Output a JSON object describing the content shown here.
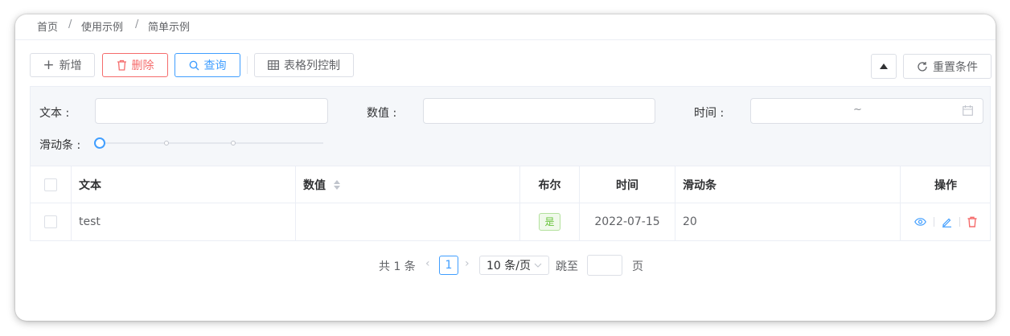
{
  "breadcrumb": {
    "home": "首页",
    "sep1": "/",
    "level2": "使用示例",
    "sep2": "/",
    "current": "简单示例"
  },
  "toolbar": {
    "add_label": "新增",
    "delete_label": "删除",
    "search_label": "查询",
    "columns_label": "表格列控制",
    "reset_label": "重置条件",
    "colors": {
      "danger": "#f56c6c",
      "primary": "#409eff"
    }
  },
  "filters": {
    "text_label": "文本 :",
    "text_value": "",
    "number_label": "数值 :",
    "number_value": "",
    "time_label": "时间 :",
    "time_range_sep": "~",
    "slider_label": "滑动条 :",
    "slider_value": 0
  },
  "table": {
    "headers": {
      "text": "文本",
      "number": "数值",
      "bool": "布尔",
      "time": "时间",
      "slider": "滑动条",
      "actions": "操作"
    },
    "rows": [
      {
        "text": "test",
        "number": "",
        "bool": "是",
        "time": "2022-07-15",
        "slider": "20"
      }
    ]
  },
  "pagination": {
    "total": "共 1 条",
    "current_page": "1",
    "page_size": "10 条/页",
    "jump_label": "跳至",
    "page_suffix": "页",
    "jump_value": ""
  }
}
